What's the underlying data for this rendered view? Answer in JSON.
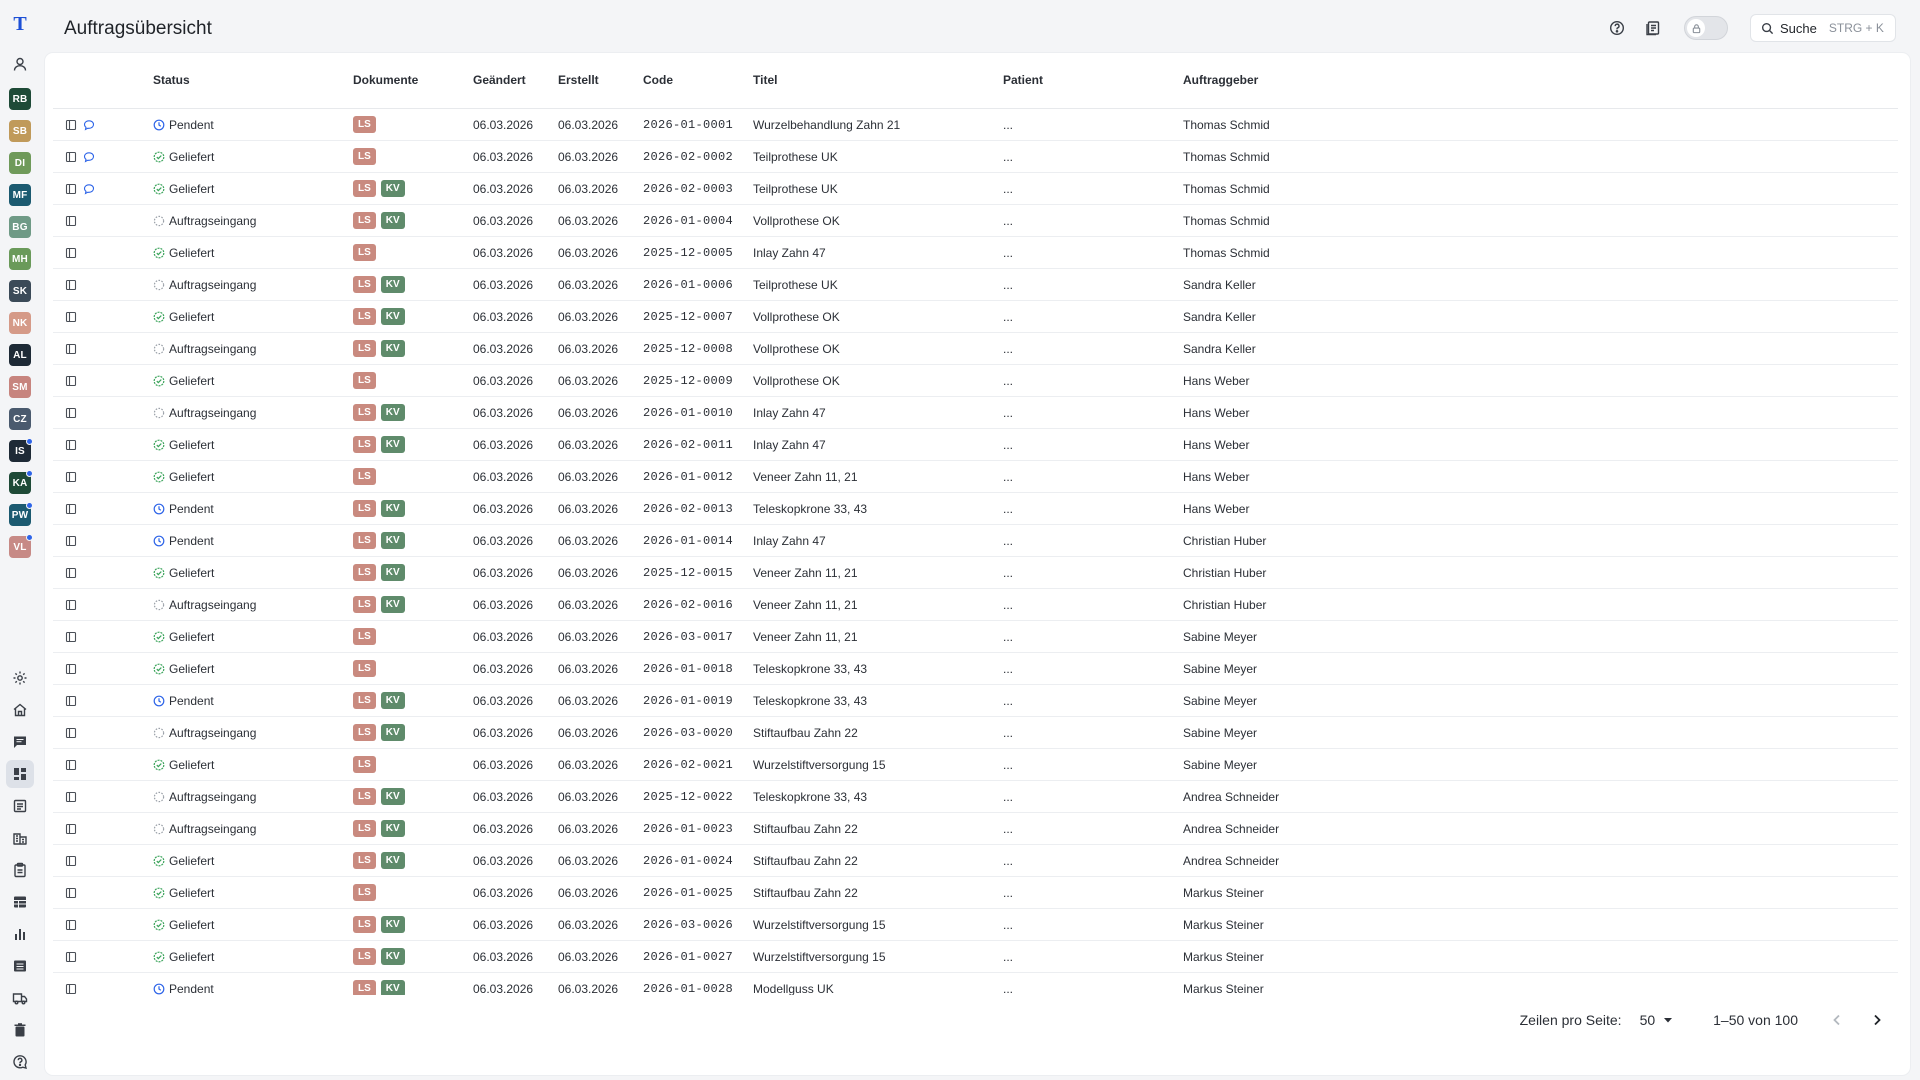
{
  "app": {
    "logo_letter": "T",
    "page_title": "Auftragsübersicht",
    "search_label": "Suche",
    "search_hint": "STRG + K"
  },
  "colors": {
    "brand": "#1c4fd6",
    "ls_badge": "#c98a7f",
    "kv_badge": "#5f8b6b",
    "pending": "#2d64e8",
    "delivered": "#3aa35a",
    "incoming": "#9aa0a8",
    "notification_dot": "#2d64e8"
  },
  "sidebar": {
    "avatars": [
      {
        "initials": "RB",
        "color": "#1e4a37",
        "dot": false
      },
      {
        "initials": "SB",
        "color": "#c09a5a",
        "dot": false
      },
      {
        "initials": "DI",
        "color": "#6f9a5a",
        "dot": false
      },
      {
        "initials": "MF",
        "color": "#1b5a70",
        "dot": false
      },
      {
        "initials": "BG",
        "color": "#6f9a86",
        "dot": false
      },
      {
        "initials": "MH",
        "color": "#6a9a5a",
        "dot": false
      },
      {
        "initials": "SK",
        "color": "#3b4a58",
        "dot": false
      },
      {
        "initials": "NK",
        "color": "#d59a88",
        "dot": false
      },
      {
        "initials": "AL",
        "color": "#1e2a36",
        "dot": false
      },
      {
        "initials": "SM",
        "color": "#c7847e",
        "dot": false
      },
      {
        "initials": "CZ",
        "color": "#4a5a6e",
        "dot": false
      },
      {
        "initials": "IS",
        "color": "#1e2a36",
        "dot": true
      },
      {
        "initials": "KA",
        "color": "#1e4a37",
        "dot": true
      },
      {
        "initials": "PW",
        "color": "#1b5a70",
        "dot": true
      },
      {
        "initials": "VL",
        "color": "#c78a86",
        "dot": true
      }
    ]
  },
  "table": {
    "columns": [
      "Status",
      "Dokumente",
      "Geändert",
      "Erstellt",
      "Code",
      "Titel",
      "Patient",
      "Auftraggeber"
    ],
    "rows": [
      {
        "status": "Pendent",
        "kind": "pending",
        "docs": [
          "LS"
        ],
        "changed": "06.03.2026",
        "created": "06.03.2026",
        "code": "2026-01-0001",
        "title": "Wurzelbehandlung Zahn 21",
        "patient": "...",
        "client": "Thomas Schmid",
        "chat": true
      },
      {
        "status": "Geliefert",
        "kind": "delivered",
        "docs": [
          "LS"
        ],
        "changed": "06.03.2026",
        "created": "06.03.2026",
        "code": "2026-02-0002",
        "title": "Teilprothese UK",
        "patient": "...",
        "client": "Thomas Schmid",
        "chat": true
      },
      {
        "status": "Geliefert",
        "kind": "delivered",
        "docs": [
          "LS",
          "KV"
        ],
        "changed": "06.03.2026",
        "created": "06.03.2026",
        "code": "2026-02-0003",
        "title": "Teilprothese UK",
        "patient": "...",
        "client": "Thomas Schmid",
        "chat": true
      },
      {
        "status": "Auftragseingang",
        "kind": "incoming",
        "docs": [
          "LS",
          "KV"
        ],
        "changed": "06.03.2026",
        "created": "06.03.2026",
        "code": "2026-01-0004",
        "title": "Vollprothese OK",
        "patient": "...",
        "client": "Thomas Schmid",
        "chat": false
      },
      {
        "status": "Geliefert",
        "kind": "delivered",
        "docs": [
          "LS"
        ],
        "changed": "06.03.2026",
        "created": "06.03.2026",
        "code": "2025-12-0005",
        "title": "Inlay Zahn 47",
        "patient": "...",
        "client": "Thomas Schmid",
        "chat": false
      },
      {
        "status": "Auftragseingang",
        "kind": "incoming",
        "docs": [
          "LS",
          "KV"
        ],
        "changed": "06.03.2026",
        "created": "06.03.2026",
        "code": "2026-01-0006",
        "title": "Teilprothese UK",
        "patient": "...",
        "client": "Sandra Keller",
        "chat": false
      },
      {
        "status": "Geliefert",
        "kind": "delivered",
        "docs": [
          "LS",
          "KV"
        ],
        "changed": "06.03.2026",
        "created": "06.03.2026",
        "code": "2025-12-0007",
        "title": "Vollprothese OK",
        "patient": "...",
        "client": "Sandra Keller",
        "chat": false
      },
      {
        "status": "Auftragseingang",
        "kind": "incoming",
        "docs": [
          "LS",
          "KV"
        ],
        "changed": "06.03.2026",
        "created": "06.03.2026",
        "code": "2025-12-0008",
        "title": "Vollprothese OK",
        "patient": "...",
        "client": "Sandra Keller",
        "chat": false
      },
      {
        "status": "Geliefert",
        "kind": "delivered",
        "docs": [
          "LS"
        ],
        "changed": "06.03.2026",
        "created": "06.03.2026",
        "code": "2025-12-0009",
        "title": "Vollprothese OK",
        "patient": "...",
        "client": "Hans Weber",
        "chat": false
      },
      {
        "status": "Auftragseingang",
        "kind": "incoming",
        "docs": [
          "LS",
          "KV"
        ],
        "changed": "06.03.2026",
        "created": "06.03.2026",
        "code": "2026-01-0010",
        "title": "Inlay Zahn 47",
        "patient": "...",
        "client": "Hans Weber",
        "chat": false
      },
      {
        "status": "Geliefert",
        "kind": "delivered",
        "docs": [
          "LS",
          "KV"
        ],
        "changed": "06.03.2026",
        "created": "06.03.2026",
        "code": "2026-02-0011",
        "title": "Inlay Zahn 47",
        "patient": "...",
        "client": "Hans Weber",
        "chat": false
      },
      {
        "status": "Geliefert",
        "kind": "delivered",
        "docs": [
          "LS"
        ],
        "changed": "06.03.2026",
        "created": "06.03.2026",
        "code": "2026-01-0012",
        "title": "Veneer Zahn 11, 21",
        "patient": "...",
        "client": "Hans Weber",
        "chat": false
      },
      {
        "status": "Pendent",
        "kind": "pending",
        "docs": [
          "LS",
          "KV"
        ],
        "changed": "06.03.2026",
        "created": "06.03.2026",
        "code": "2026-02-0013",
        "title": "Teleskopkrone 33, 43",
        "patient": "...",
        "client": "Hans Weber",
        "chat": false
      },
      {
        "status": "Pendent",
        "kind": "pending",
        "docs": [
          "LS",
          "KV"
        ],
        "changed": "06.03.2026",
        "created": "06.03.2026",
        "code": "2026-01-0014",
        "title": "Inlay Zahn 47",
        "patient": "...",
        "client": "Christian Huber",
        "chat": false
      },
      {
        "status": "Geliefert",
        "kind": "delivered",
        "docs": [
          "LS",
          "KV"
        ],
        "changed": "06.03.2026",
        "created": "06.03.2026",
        "code": "2025-12-0015",
        "title": "Veneer Zahn 11, 21",
        "patient": "...",
        "client": "Christian Huber",
        "chat": false
      },
      {
        "status": "Auftragseingang",
        "kind": "incoming",
        "docs": [
          "LS",
          "KV"
        ],
        "changed": "06.03.2026",
        "created": "06.03.2026",
        "code": "2026-02-0016",
        "title": "Veneer Zahn 11, 21",
        "patient": "...",
        "client": "Christian Huber",
        "chat": false
      },
      {
        "status": "Geliefert",
        "kind": "delivered",
        "docs": [
          "LS"
        ],
        "changed": "06.03.2026",
        "created": "06.03.2026",
        "code": "2026-03-0017",
        "title": "Veneer Zahn 11, 21",
        "patient": "...",
        "client": "Sabine Meyer",
        "chat": false
      },
      {
        "status": "Geliefert",
        "kind": "delivered",
        "docs": [
          "LS"
        ],
        "changed": "06.03.2026",
        "created": "06.03.2026",
        "code": "2026-01-0018",
        "title": "Teleskopkrone 33, 43",
        "patient": "...",
        "client": "Sabine Meyer",
        "chat": false
      },
      {
        "status": "Pendent",
        "kind": "pending",
        "docs": [
          "LS",
          "KV"
        ],
        "changed": "06.03.2026",
        "created": "06.03.2026",
        "code": "2026-01-0019",
        "title": "Teleskopkrone 33, 43",
        "patient": "...",
        "client": "Sabine Meyer",
        "chat": false
      },
      {
        "status": "Auftragseingang",
        "kind": "incoming",
        "docs": [
          "LS",
          "KV"
        ],
        "changed": "06.03.2026",
        "created": "06.03.2026",
        "code": "2026-03-0020",
        "title": "Stiftaufbau Zahn 22",
        "patient": "...",
        "client": "Sabine Meyer",
        "chat": false
      },
      {
        "status": "Geliefert",
        "kind": "delivered",
        "docs": [
          "LS"
        ],
        "changed": "06.03.2026",
        "created": "06.03.2026",
        "code": "2026-02-0021",
        "title": "Wurzelstiftversorgung 15",
        "patient": "...",
        "client": "Sabine Meyer",
        "chat": false
      },
      {
        "status": "Auftragseingang",
        "kind": "incoming",
        "docs": [
          "LS",
          "KV"
        ],
        "changed": "06.03.2026",
        "created": "06.03.2026",
        "code": "2025-12-0022",
        "title": "Teleskopkrone 33, 43",
        "patient": "...",
        "client": "Andrea Schneider",
        "chat": false
      },
      {
        "status": "Auftragseingang",
        "kind": "incoming",
        "docs": [
          "LS",
          "KV"
        ],
        "changed": "06.03.2026",
        "created": "06.03.2026",
        "code": "2026-01-0023",
        "title": "Stiftaufbau Zahn 22",
        "patient": "...",
        "client": "Andrea Schneider",
        "chat": false
      },
      {
        "status": "Geliefert",
        "kind": "delivered",
        "docs": [
          "LS",
          "KV"
        ],
        "changed": "06.03.2026",
        "created": "06.03.2026",
        "code": "2026-01-0024",
        "title": "Stiftaufbau Zahn 22",
        "patient": "...",
        "client": "Andrea Schneider",
        "chat": false
      },
      {
        "status": "Geliefert",
        "kind": "delivered",
        "docs": [
          "LS"
        ],
        "changed": "06.03.2026",
        "created": "06.03.2026",
        "code": "2026-01-0025",
        "title": "Stiftaufbau Zahn 22",
        "patient": "...",
        "client": "Markus Steiner",
        "chat": false
      },
      {
        "status": "Geliefert",
        "kind": "delivered",
        "docs": [
          "LS",
          "KV"
        ],
        "changed": "06.03.2026",
        "created": "06.03.2026",
        "code": "2026-03-0026",
        "title": "Wurzelstiftversorgung 15",
        "patient": "...",
        "client": "Markus Steiner",
        "chat": false
      },
      {
        "status": "Geliefert",
        "kind": "delivered",
        "docs": [
          "LS",
          "KV"
        ],
        "changed": "06.03.2026",
        "created": "06.03.2026",
        "code": "2026-01-0027",
        "title": "Wurzelstiftversorgung 15",
        "patient": "...",
        "client": "Markus Steiner",
        "chat": false
      },
      {
        "status": "Pendent",
        "kind": "pending",
        "docs": [
          "LS",
          "KV"
        ],
        "changed": "06.03.2026",
        "created": "06.03.2026",
        "code": "2026-01-0028",
        "title": "Modellguss UK",
        "patient": "...",
        "client": "Markus Steiner",
        "chat": false
      }
    ]
  },
  "pagination": {
    "rows_per_page_label": "Zeilen pro Seite:",
    "rows_per_page": "50",
    "range": "1–50 von 100"
  }
}
